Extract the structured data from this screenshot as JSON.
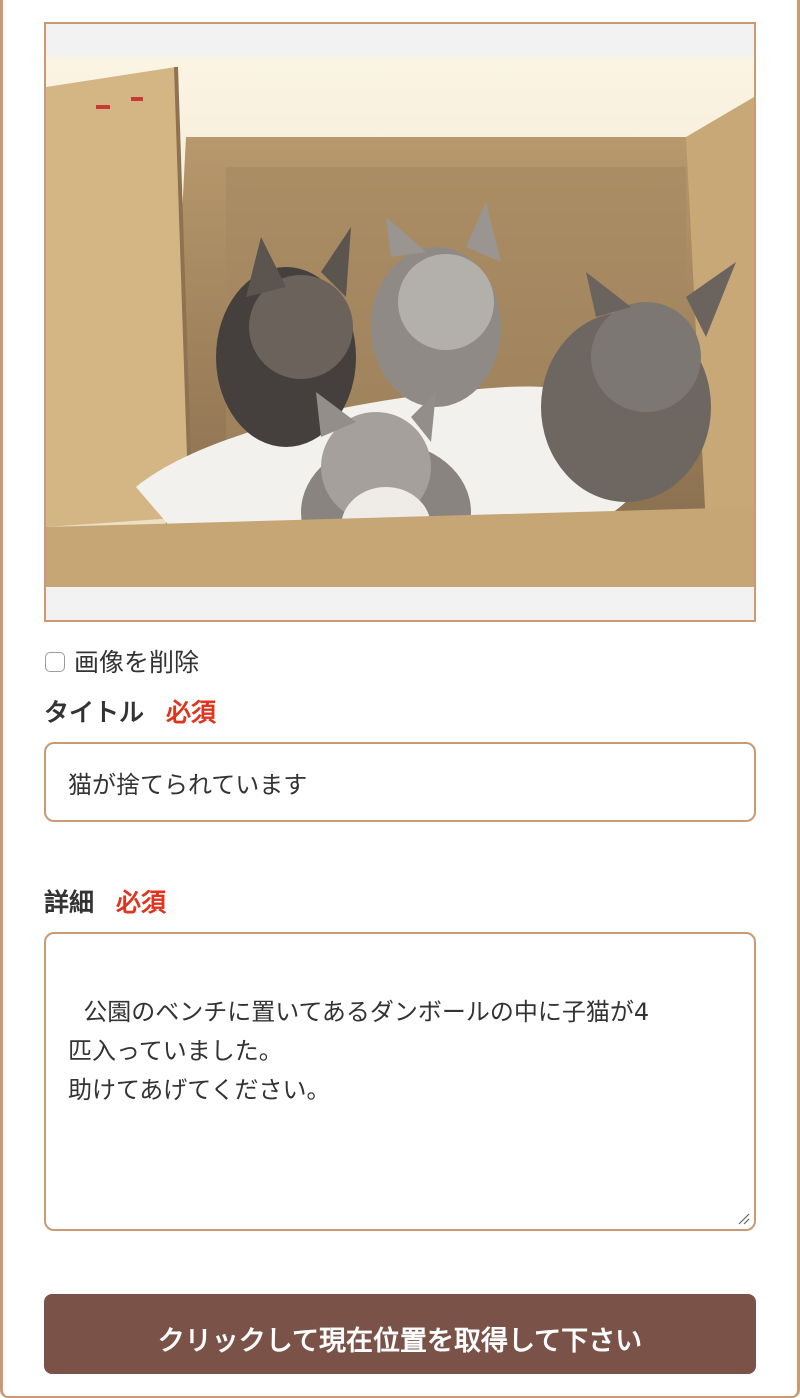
{
  "image": {
    "name": "kittens-in-box-photo",
    "colors": {
      "box": "#d7b98a",
      "box_dark": "#b0916a",
      "towel": "#f3f1ee",
      "kitten_gray": "#7d7773",
      "kitten_dark": "#45403d"
    }
  },
  "delete_image": {
    "label": "画像を削除",
    "checked": false
  },
  "title_field": {
    "label": "タイトル",
    "required": "必須",
    "value": "猫が捨てられています"
  },
  "detail_field": {
    "label": "詳細",
    "required": "必須",
    "value": "公園のベンチに置いてあるダンボールの中に子猫が4\n匹入っていました。\n助けてあげてください。"
  },
  "location_button": {
    "label": "クリックして現在位置を取得して下さい"
  },
  "colors": {
    "accent_border": "#c99a74",
    "required": "#e0341f",
    "button": "#7a5247"
  }
}
